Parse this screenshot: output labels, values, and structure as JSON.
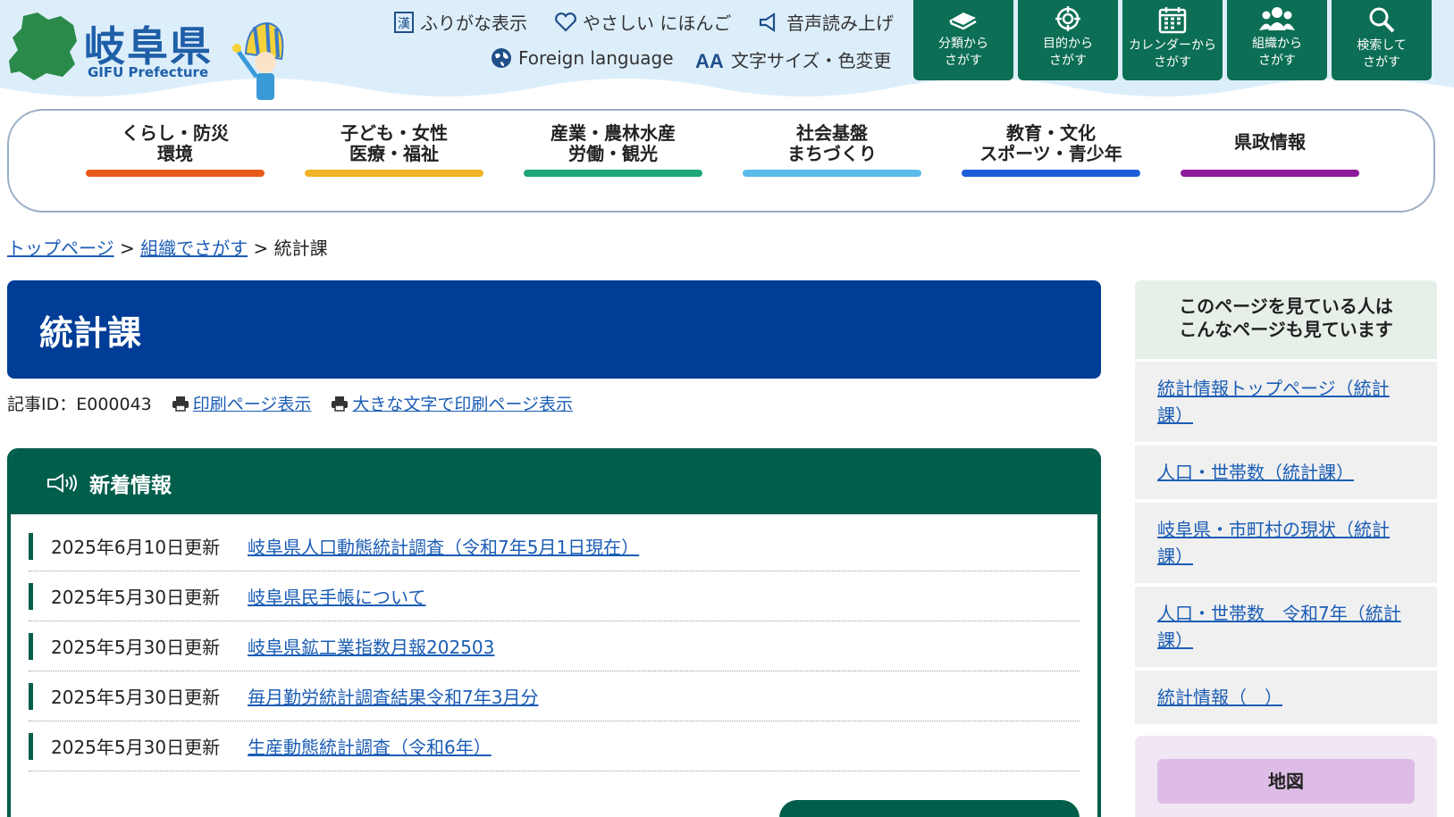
{
  "logo": {
    "title": "岐阜県",
    "subtitle": "GIFU Prefecture"
  },
  "utility": {
    "furigana": "ふりがな表示",
    "easy_japanese": "やさしい にほんご",
    "voice": "音声読み上げ",
    "foreign": "Foreign language",
    "text_size": "文字サイズ・色変更"
  },
  "nav_buttons": [
    {
      "line1": "分類から",
      "line2": "さがす"
    },
    {
      "line1": "目的から",
      "line2": "さがす"
    },
    {
      "line1": "カレンダーから",
      "line2": "さがす"
    },
    {
      "line1": "組織から",
      "line2": "さがす"
    },
    {
      "line1": "検索して",
      "line2": "さがす"
    }
  ],
  "global_nav": [
    {
      "line1": "くらし・防災",
      "line2": "環境",
      "color": "#e85a1c"
    },
    {
      "line1": "子ども・女性",
      "line2": "医療・福祉",
      "color": "#f0b323"
    },
    {
      "line1": "産業・農林水産",
      "line2": "労働・観光",
      "color": "#1fa57a"
    },
    {
      "line1": "社会基盤",
      "line2": "まちづくり",
      "color": "#5bbbe9"
    },
    {
      "line1": "教育・文化",
      "line2": "スポーツ・青少年",
      "color": "#1b5ed8"
    },
    {
      "line1": "県政情報",
      "line2": "",
      "color": "#8d1a9a"
    }
  ],
  "breadcrumb": {
    "home": "トップページ",
    "sep": ">",
    "org": "組織でさがす",
    "current": "統計課"
  },
  "page": {
    "title": "統計課",
    "article_id": "記事ID：E000043",
    "print_link": "印刷ページ表示",
    "print_large_link": "大きな文字で印刷ページ表示"
  },
  "news": {
    "heading": "新着情報",
    "items": [
      {
        "date": "2025年6月10日更新",
        "title": "岐阜県人口動態統計調査（令和7年5月1日現在）"
      },
      {
        "date": "2025年5月30日更新",
        "title": "岐阜県民手帳について"
      },
      {
        "date": "2025年5月30日更新",
        "title": "岐阜県鉱工業指数月報202503"
      },
      {
        "date": "2025年5月30日更新",
        "title": "毎月勤労統計調査結果令和7年3月分"
      },
      {
        "date": "2025年5月30日更新",
        "title": "生産動態統計調査（令和6年）"
      }
    ]
  },
  "sidebar": {
    "heading_line1": "このページを見ている人は",
    "heading_line2": "こんなページも見ています",
    "links": [
      "統計情報トップページ（統計課）",
      "人口・世帯数（統計課）",
      "岐阜県・市町村の現状（統計課）",
      "人口・世帯数　令和7年（統計課）",
      "統計情報（　）"
    ],
    "map_label": "地図"
  }
}
